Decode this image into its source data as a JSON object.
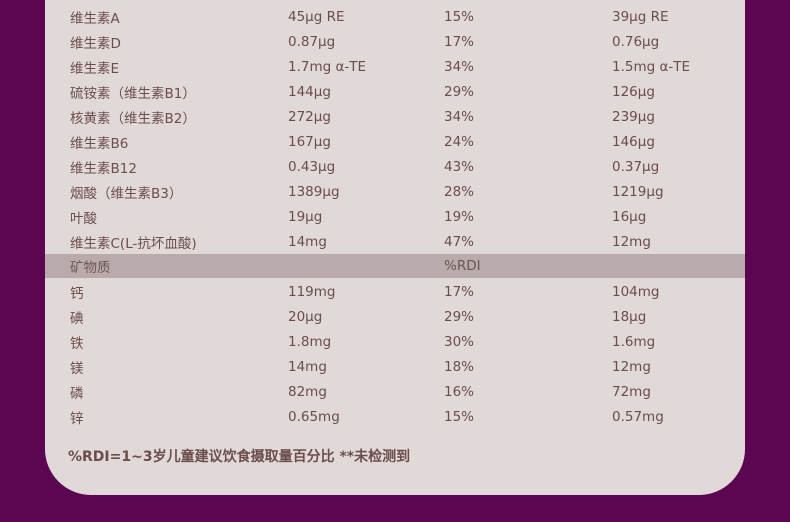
{
  "vitamins": [
    [
      "维生素A",
      "45μg RE",
      "15%",
      "39μg RE"
    ],
    [
      "维生素D",
      "0.87μg",
      "17%",
      "0.76μg"
    ],
    [
      "维生素E",
      "1.7mg α-TE",
      "34%",
      "1.5mg α-TE"
    ],
    [
      "硫铵素（维生素B1）",
      "144μg",
      "29%",
      "126μg"
    ],
    [
      "核黄素（维生素B2）",
      "272μg",
      "34%",
      "239μg"
    ],
    [
      "维生素B6",
      "167μg",
      "24%",
      "146μg"
    ],
    [
      "维生素B12",
      "0.43μg",
      "43%",
      "0.37μg"
    ],
    [
      "烟酸（维生素B3）",
      "1389μg",
      "28%",
      "1219μg"
    ],
    [
      "叶酸",
      "19μg",
      "19%",
      "16μg"
    ],
    [
      "维生素C(L-抗坏血酸)",
      "14mg",
      "47%",
      "12mg"
    ]
  ],
  "minerals_header": {
    "label": "矿物质",
    "rdi": "%RDI"
  },
  "minerals": [
    [
      "钙",
      "119mg",
      "17%",
      "104mg"
    ],
    [
      "碘",
      "20μg",
      "29%",
      "18μg"
    ],
    [
      "铁",
      "1.8mg",
      "30%",
      "1.6mg"
    ],
    [
      "镁",
      "14mg",
      "18%",
      "12mg"
    ],
    [
      "磷",
      "82mg",
      "16%",
      "72mg"
    ],
    [
      "锌",
      "0.65mg",
      "15%",
      "0.57mg"
    ]
  ],
  "footnote": "%RDI=1~3岁儿童建议饮食摄取量百分比  **未检测到"
}
